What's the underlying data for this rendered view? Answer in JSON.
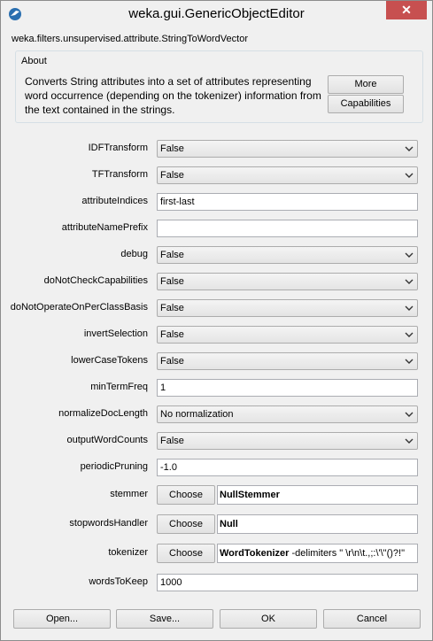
{
  "window": {
    "title": "weka.gui.GenericObjectEditor",
    "close_label": "✕"
  },
  "class_name": "weka.filters.unsupervised.attribute.StringToWordVector",
  "about": {
    "title": "About",
    "text": "Converts String attributes into a set of attributes representing word occurrence (depending on the tokenizer) information from the text contained in the strings.",
    "more_label": "More",
    "capabilities_label": "Capabilities"
  },
  "properties": {
    "IDFTransform": {
      "label": "IDFTransform",
      "value": "False"
    },
    "TFTransform": {
      "label": "TFTransform",
      "value": "False"
    },
    "attributeIndices": {
      "label": "attributeIndices",
      "value": "first-last"
    },
    "attributeNamePrefix": {
      "label": "attributeNamePrefix",
      "value": ""
    },
    "debug": {
      "label": "debug",
      "value": "False"
    },
    "doNotCheckCapabilities": {
      "label": "doNotCheckCapabilities",
      "value": "False"
    },
    "doNotOperateOnPerClassBasis": {
      "label": "doNotOperateOnPerClassBasis",
      "value": "False"
    },
    "invertSelection": {
      "label": "invertSelection",
      "value": "False"
    },
    "lowerCaseTokens": {
      "label": "lowerCaseTokens",
      "value": "False"
    },
    "minTermFreq": {
      "label": "minTermFreq",
      "value": "1"
    },
    "normalizeDocLength": {
      "label": "normalizeDocLength",
      "value": "No normalization"
    },
    "outputWordCounts": {
      "label": "outputWordCounts",
      "value": "False"
    },
    "periodicPruning": {
      "label": "periodicPruning",
      "value": "-1.0"
    },
    "stemmer": {
      "label": "stemmer",
      "choose_label": "Choose",
      "value_bold": "NullStemmer",
      "value_rest": ""
    },
    "stopwordsHandler": {
      "label": "stopwordsHandler",
      "choose_label": "Choose",
      "value_bold": "Null",
      "value_rest": ""
    },
    "tokenizer": {
      "label": "tokenizer",
      "choose_label": "Choose",
      "value_bold": "WordTokenizer",
      "value_rest": " -delimiters \" \\r\\n\\t.,;:\\'\\\"()?!\""
    },
    "wordsToKeep": {
      "label": "wordsToKeep",
      "value": "1000"
    }
  },
  "buttons": {
    "open": "Open...",
    "save": "Save...",
    "ok": "OK",
    "cancel": "Cancel"
  },
  "icons": {
    "title": "weka-bird-icon",
    "dropdown": "chevron-down-icon"
  }
}
